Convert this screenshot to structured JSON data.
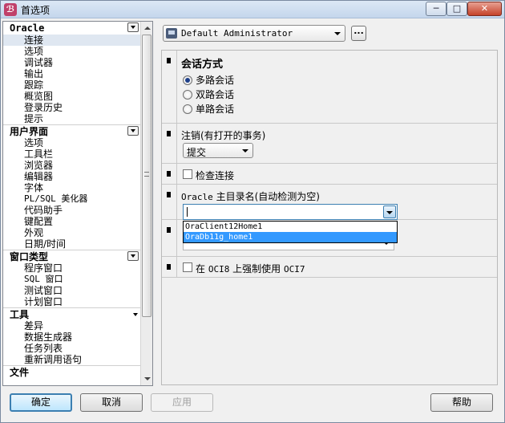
{
  "window": {
    "title": "首选项",
    "app_icon_glyph": "ℬ",
    "controls": {
      "minimize": "─",
      "maximize": "□",
      "close": "✕"
    }
  },
  "left_panel": {
    "sections": [
      {
        "title": "Oracle",
        "control": "collapse",
        "items": [
          "连接",
          "选项",
          "调试器",
          "输出",
          "跟踪",
          "概览图",
          "登录历史",
          "提示"
        ],
        "selected_index": 0
      },
      {
        "title": "用户界面",
        "control": "collapse",
        "items": [
          "选项",
          "工具栏",
          "浏览器",
          "编辑器",
          "字体",
          "PL/SQL 美化器",
          "代码助手",
          "键配置",
          "外观",
          "日期/时间"
        ]
      },
      {
        "title": "窗口类型",
        "control": "collapse",
        "items": [
          "程序窗口",
          "SQL 窗口",
          "测试窗口",
          "计划窗口"
        ]
      },
      {
        "title": "工具",
        "control": "arrow",
        "items": [
          "差异",
          "数据生成器",
          "任务列表",
          "重新调用语句"
        ]
      },
      {
        "title": "文件",
        "control": "none",
        "items": []
      }
    ]
  },
  "profile": {
    "value": "Default Administrator",
    "more_label": "..."
  },
  "session": {
    "title": "会话方式",
    "options": [
      "多路会话",
      "双路会话",
      "单路会话"
    ],
    "selected_index": 0
  },
  "logoff": {
    "label": "注销(有打开的事务)",
    "value": "提交"
  },
  "check_connection": {
    "label": "检查连接",
    "checked": false
  },
  "oracle_home": {
    "label_prefix": "Oracle",
    "label_suffix": " 主目录名(自动检测为空)",
    "value": "",
    "dropdown_items": [
      "OraClient12Home1",
      "OraDb11g_home1"
    ],
    "highlighted_index": 1
  },
  "oci7": {
    "label_prefix": "在 ",
    "label_mono1": "OCI8",
    "label_mid": " 上强制使用 ",
    "label_mono2": "OCI7",
    "checked": false
  },
  "buttons": {
    "ok": "确定",
    "cancel": "取消",
    "apply": "应用",
    "help": "帮助"
  }
}
